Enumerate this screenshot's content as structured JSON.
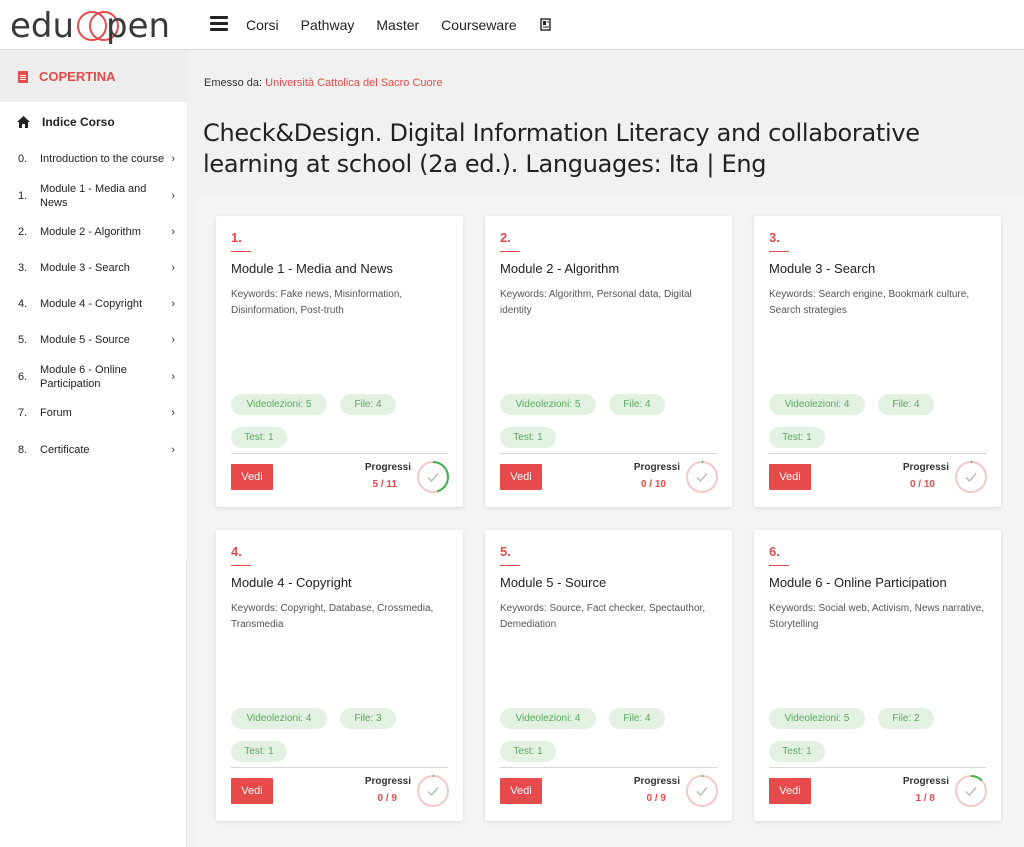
{
  "header": {
    "logo_text": "eduopen",
    "nav": [
      "Corsi",
      "Pathway",
      "Master",
      "Courseware"
    ]
  },
  "sidebar": {
    "copertina": "COPERTINA",
    "indice": "Indice Corso",
    "items": [
      {
        "num": "0.",
        "label": "Introduction to the course"
      },
      {
        "num": "1.",
        "label": "Module 1 - Media and News"
      },
      {
        "num": "2.",
        "label": "Module 2 - Algorithm"
      },
      {
        "num": "3.",
        "label": "Module 3 - Search"
      },
      {
        "num": "4.",
        "label": "Module 4 - Copyright"
      },
      {
        "num": "5.",
        "label": "Module 5 - Source"
      },
      {
        "num": "6.",
        "label": "Module 6 - Online Participation"
      },
      {
        "num": "7.",
        "label": "Forum"
      },
      {
        "num": "8.",
        "label": "Certificate"
      }
    ]
  },
  "course": {
    "emesso_label": "Emesso da: ",
    "university": "Università Cattolica del Sacro Cuore",
    "title": "Check&Design. Digital Information Literacy and collaborative learning at school (2a ed.). Languages: Ita | Eng"
  },
  "cards": [
    {
      "num": "1.",
      "title": "Module 1 - Media and News",
      "keywords": "Keywords: Fake news, Misinformation, Disinformation, Post-truth",
      "videolezioni": "Videolezioni: 5",
      "file": "File: 4",
      "test": "Test: 1",
      "vedi": "Vedi",
      "progress_label": "Progressi",
      "progress": "5 / 11",
      "done": 5,
      "total": 11
    },
    {
      "num": "2.",
      "title": "Module 2 - Algorithm",
      "keywords": "Keywords: Algorithm, Personal data, Digital identity",
      "videolezioni": "Videolezioni: 5",
      "file": "File: 4",
      "test": "Test: 1",
      "vedi": "Vedi",
      "progress_label": "Progressi",
      "progress": "0 / 10",
      "done": 0,
      "total": 10
    },
    {
      "num": "3.",
      "title": "Module 3 - Search",
      "keywords": "Keywords: Search engine, Bookmark culture, Search strategies",
      "videolezioni": "Videolezioni: 4",
      "file": "File: 4",
      "test": "Test: 1",
      "vedi": "Vedi",
      "progress_label": "Progressi",
      "progress": "0 / 10",
      "done": 0,
      "total": 10
    },
    {
      "num": "4.",
      "title": "Module 4 - Copyright",
      "keywords": "Keywords: Copyright, Database, Crossmedia, Transmedia",
      "videolezioni": "Videolezioni: 4",
      "file": "File: 3",
      "test": "Test: 1",
      "vedi": "Vedi",
      "progress_label": "Progressi",
      "progress": "0 / 9",
      "done": 0,
      "total": 9
    },
    {
      "num": "5.",
      "title": "Module 5 - Source",
      "keywords": "Keywords: Source, Fact checker, Spectauthor, Demediation",
      "videolezioni": "Videolezioni: 4",
      "file": "File: 4",
      "test": "Test: 1",
      "vedi": "Vedi",
      "progress_label": "Progressi",
      "progress": "0 / 9",
      "done": 0,
      "total": 9
    },
    {
      "num": "6.",
      "title": "Module 6 - Online Participation",
      "keywords": "Keywords: Social web, Activism, News narrative, Storytelling",
      "videolezioni": "Videolezioni: 5",
      "file": "File: 2",
      "test": "Test: 1",
      "vedi": "Vedi",
      "progress_label": "Progressi",
      "progress": "1 / 8",
      "done": 1,
      "total": 8
    }
  ],
  "colors": {
    "accent": "#e64a4a",
    "progress": "#3cb64a",
    "ring_bg": "#f2c9c6",
    "pill_bg": "#e3f1e3",
    "pill_text": "#5aa95a"
  }
}
